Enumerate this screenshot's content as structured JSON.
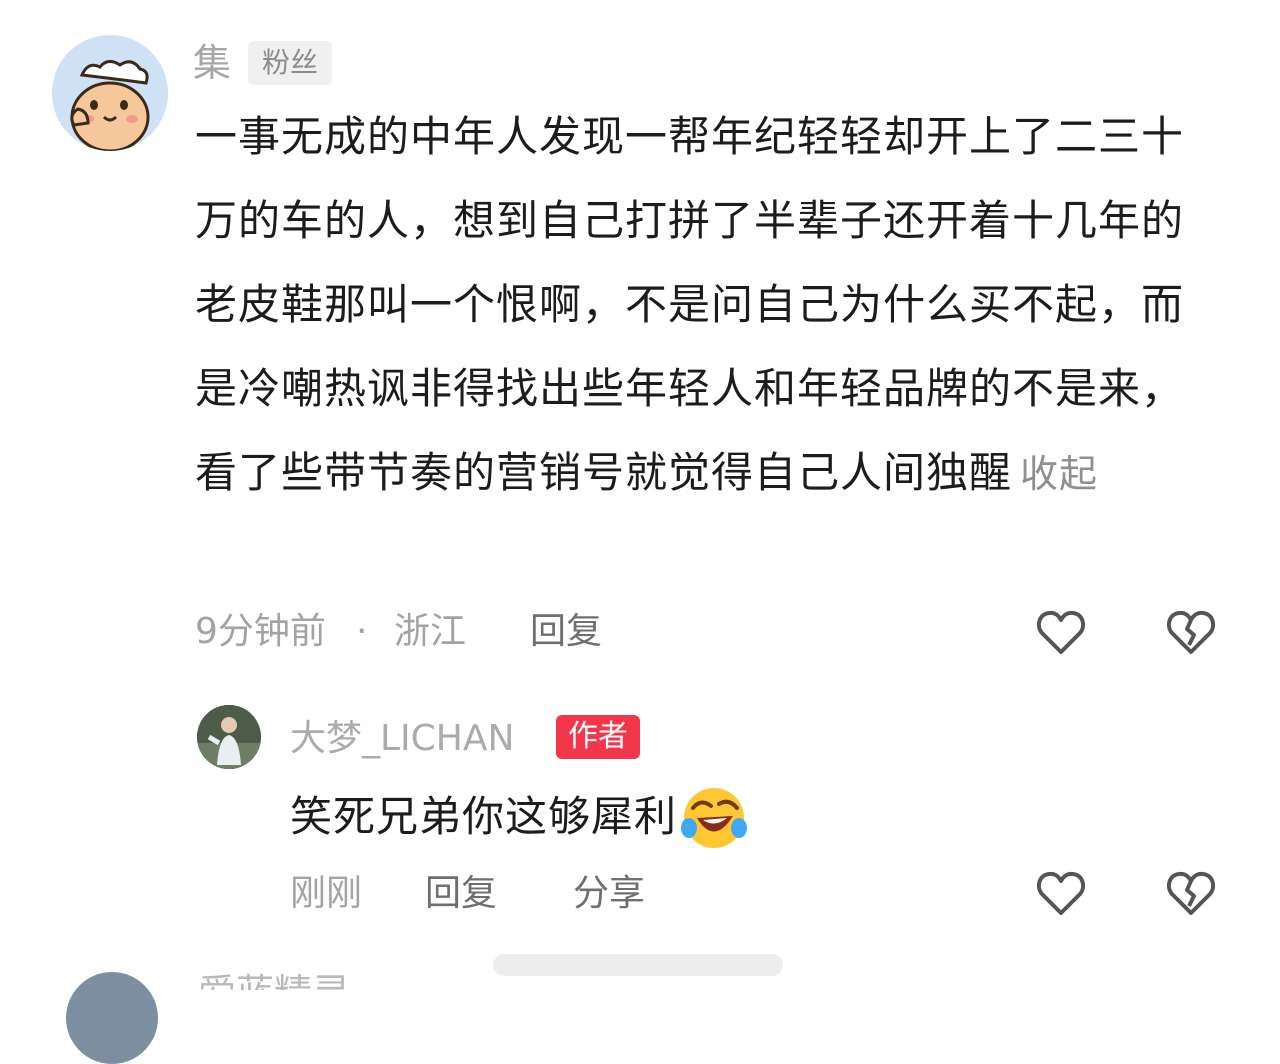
{
  "comment": {
    "author": "集",
    "badge": "粉丝",
    "text": "一事无成的中年人发现一帮年纪轻轻却开上了二三十万的车的人，想到自己打拼了半辈子还开着十几年的老皮鞋那叫一个恨啊，不是问自己为什么买不起，而是冷嘲热讽非得找出些年轻人和年轻品牌的不是来，看了些带节奏的营销号就觉得自己人间独醒",
    "collapse_label": "收起",
    "time": "9分钟前",
    "separator": "·",
    "location": "浙江",
    "reply_label": "回复",
    "like_icon": "heart-outline-icon",
    "dislike_icon": "broken-heart-icon"
  },
  "reply": {
    "author": "大梦_LICHAN",
    "badge": "作者",
    "text": "笑死兄弟你这够犀利",
    "emoji": "rolling-laughing-emoji",
    "time": "刚刚",
    "reply_label": "回复",
    "share_label": "分享",
    "like_icon": "heart-outline-icon",
    "dislike_icon": "broken-heart-icon"
  },
  "next_comment": {
    "author_partial": "爱蓝精灵"
  },
  "colors": {
    "author_badge": "#f4364c",
    "muted_text": "#a3a3a3",
    "body_text": "#1c1c1c"
  }
}
